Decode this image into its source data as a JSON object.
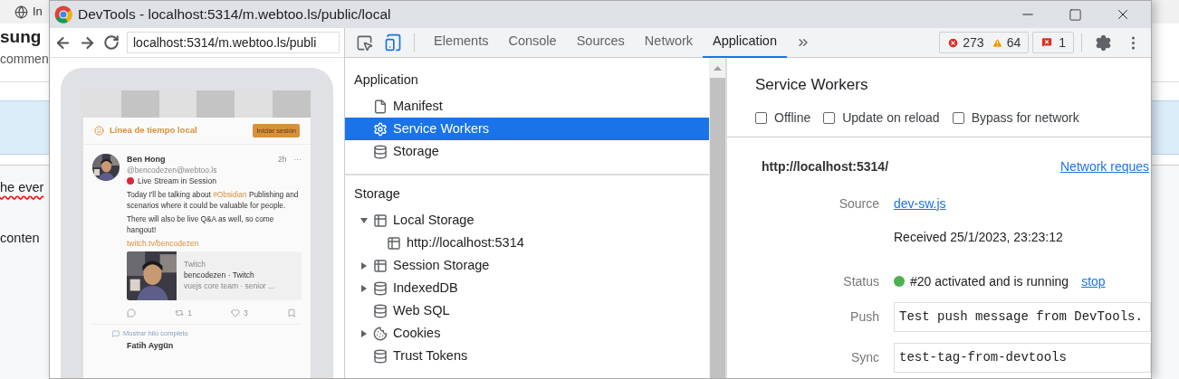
{
  "background": {
    "tab_title": "In",
    "heading": "sung",
    "subtitle": "commen",
    "lines": [
      {
        "text": "he ever",
        "misspelled": true
      },
      {
        "text": "conten",
        "misspelled": false
      }
    ]
  },
  "window": {
    "title": "DevTools - localhost:5314/m.webtoo.ls/public/local"
  },
  "preview": {
    "url": "localhost:5314/m.webtoo.ls/publi",
    "header_title": "Línea de tiempo local",
    "login_button": "Iniciar sesión",
    "post": {
      "author": "Ben Hong",
      "handle": "@bencodezen@webtoo.ls",
      "time": "2h",
      "more": "···",
      "live": "Live Stream in Session",
      "intro": "Today I'll be talking about",
      "hashtag": "#Obsidian",
      "intro_rest": "Publishing and scenarios where it could be valuable for people.",
      "outro": "There will also be live Q&A as well, so come hangout!",
      "link": "twitch.tv/bencodezen",
      "card": {
        "site": "Twitch",
        "title": "bencodezen · Twitch",
        "description": "vuejs core team · senior ..."
      },
      "reposts": "1",
      "likes": "3"
    },
    "thread_link": "Mostrar hilo completo",
    "next_author": "Fatih Aygün"
  },
  "toolbar": {
    "tabs": [
      {
        "label": "Elements",
        "selected": false
      },
      {
        "label": "Console",
        "selected": false
      },
      {
        "label": "Sources",
        "selected": false
      },
      {
        "label": "Network",
        "selected": false
      },
      {
        "label": "Application",
        "selected": true
      }
    ],
    "errors": "273",
    "warnings": "64",
    "issues": "1"
  },
  "sidebar": {
    "sections": [
      {
        "title": "Application",
        "items": [
          {
            "label": "Manifest",
            "kind": "file",
            "selected": false
          },
          {
            "label": "Service Workers",
            "kind": "gear",
            "selected": true
          },
          {
            "label": "Storage",
            "kind": "database",
            "selected": false
          }
        ]
      },
      {
        "title": "Storage",
        "items": [
          {
            "label": "Local Storage",
            "kind": "table",
            "selected": false,
            "expanded": true,
            "children": [
              {
                "label": "http://localhost:5314",
                "kind": "table",
                "selected": false
              }
            ]
          },
          {
            "label": "Session Storage",
            "kind": "table",
            "selected": false,
            "expanded": false
          },
          {
            "label": "IndexedDB",
            "kind": "database",
            "selected": false,
            "expanded": false
          },
          {
            "label": "Web SQL",
            "kind": "database",
            "selected": false
          },
          {
            "label": "Cookies",
            "kind": "cookie",
            "selected": false,
            "expanded": false
          },
          {
            "label": "Trust Tokens",
            "kind": "database",
            "selected": false
          }
        ]
      }
    ]
  },
  "panel": {
    "title": "Service Workers",
    "options": [
      {
        "label": "Offline",
        "checked": false
      },
      {
        "label": "Update on reload",
        "checked": false
      },
      {
        "label": "Bypass for network",
        "checked": false
      }
    ],
    "origin": "http://localhost:5314/",
    "network_link": "Network reques",
    "source_label": "Source",
    "source": "dev-sw.js",
    "received": "Received 25/1/2023, 23:23:12",
    "status_label": "Status",
    "status": "#20 activated and is running",
    "status_active": true,
    "stop": "stop",
    "push_label": "Push",
    "push": "Test push message from DevTools.",
    "sync_label": "Sync",
    "sync": "test-tag-from-devtools"
  }
}
